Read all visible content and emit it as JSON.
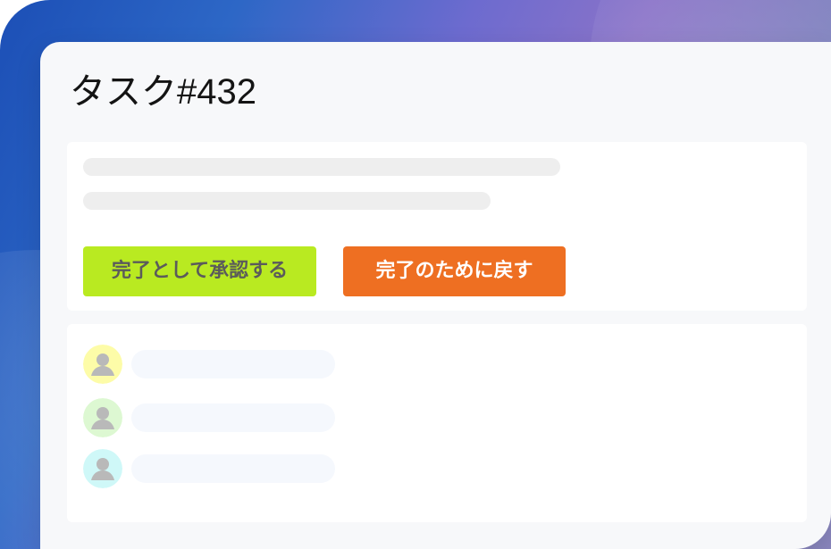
{
  "task": {
    "title": "タスク#432"
  },
  "actions": {
    "approve_label": "完了として承認する",
    "return_label": "完了のために戻す"
  },
  "comments": {
    "avatars": [
      {
        "icon": "user-icon",
        "bg_color": "#fdfca8"
      },
      {
        "icon": "user-icon",
        "bg_color": "#ddf8d2"
      },
      {
        "icon": "user-icon",
        "bg_color": "#cff8f8"
      }
    ]
  },
  "theme": {
    "approve_color": "#b9ea21",
    "return_color": "#ee6f22"
  }
}
